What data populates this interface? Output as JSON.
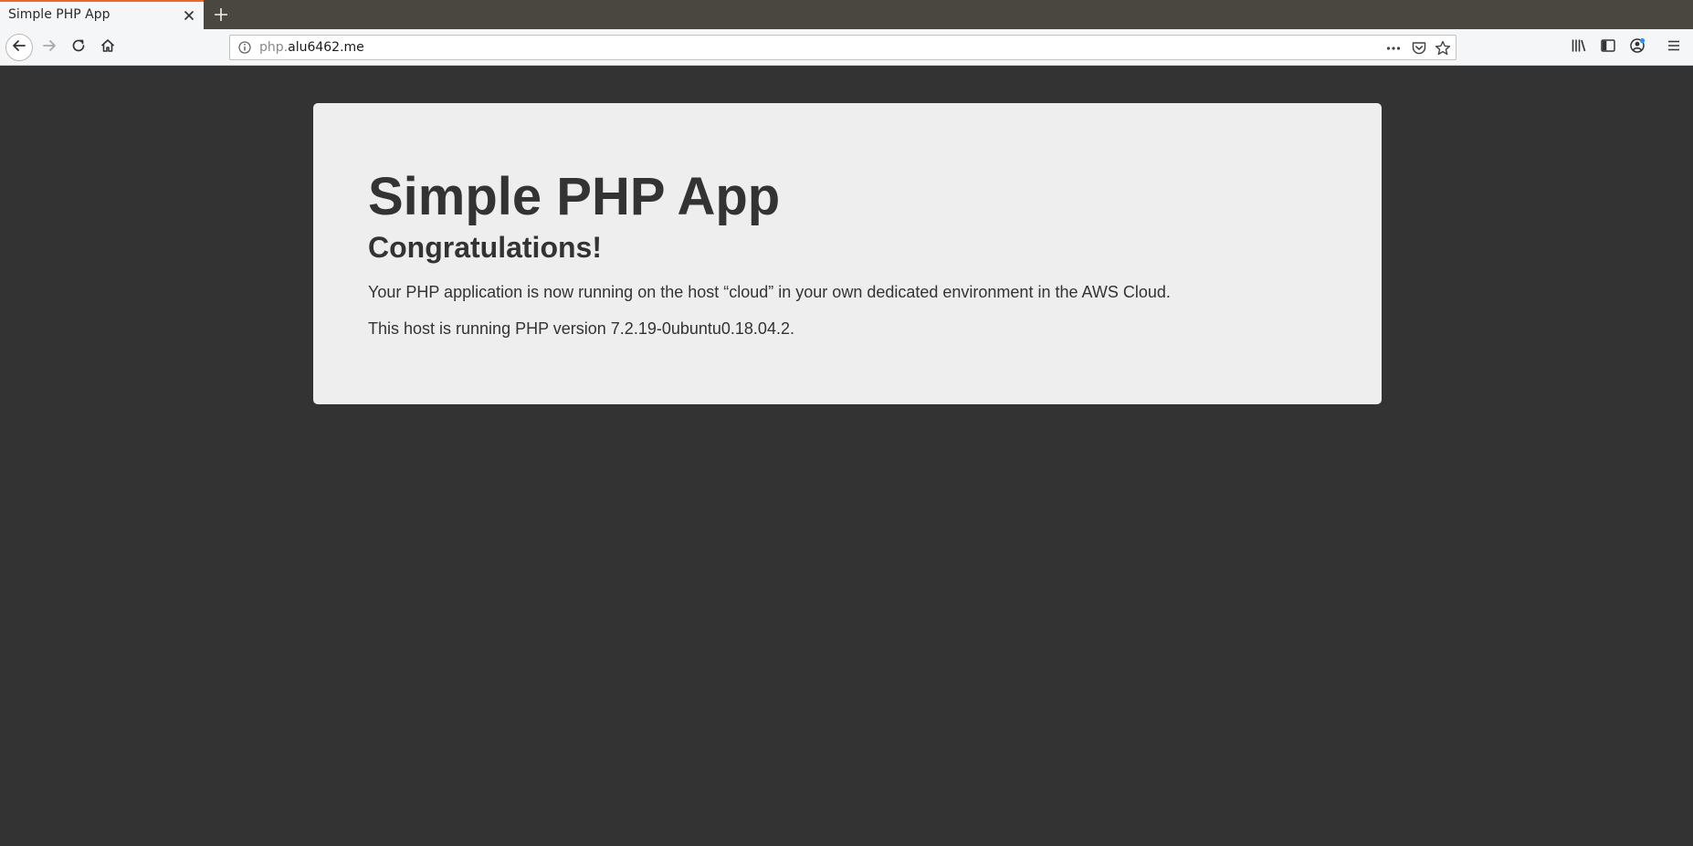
{
  "browser": {
    "tab": {
      "title": "Simple PHP App"
    },
    "url": {
      "subdomain": "php.",
      "domain": "alu6462.me"
    },
    "accent_color": "#e86a2c"
  },
  "page": {
    "heading": "Simple PHP App",
    "subheading": "Congratulations!",
    "message": "Your PHP application is now running on the host “cloud” in your own dedicated environment in the AWS Cloud.",
    "version_text": "This host is running PHP version 7.2.19-0ubuntu0.18.04.2."
  },
  "icons": {
    "tab_close": "close-icon",
    "new_tab": "plus-icon",
    "back": "arrow-left-icon",
    "forward": "arrow-right-icon",
    "reload": "reload-icon",
    "home": "home-icon",
    "info": "info-icon",
    "page_actions": "more-horizontal-icon",
    "pocket": "pocket-icon",
    "bookmark": "star-icon",
    "library": "library-icon",
    "sidebar": "sidebar-icon",
    "account": "account-icon",
    "menu": "hamburger-icon"
  }
}
